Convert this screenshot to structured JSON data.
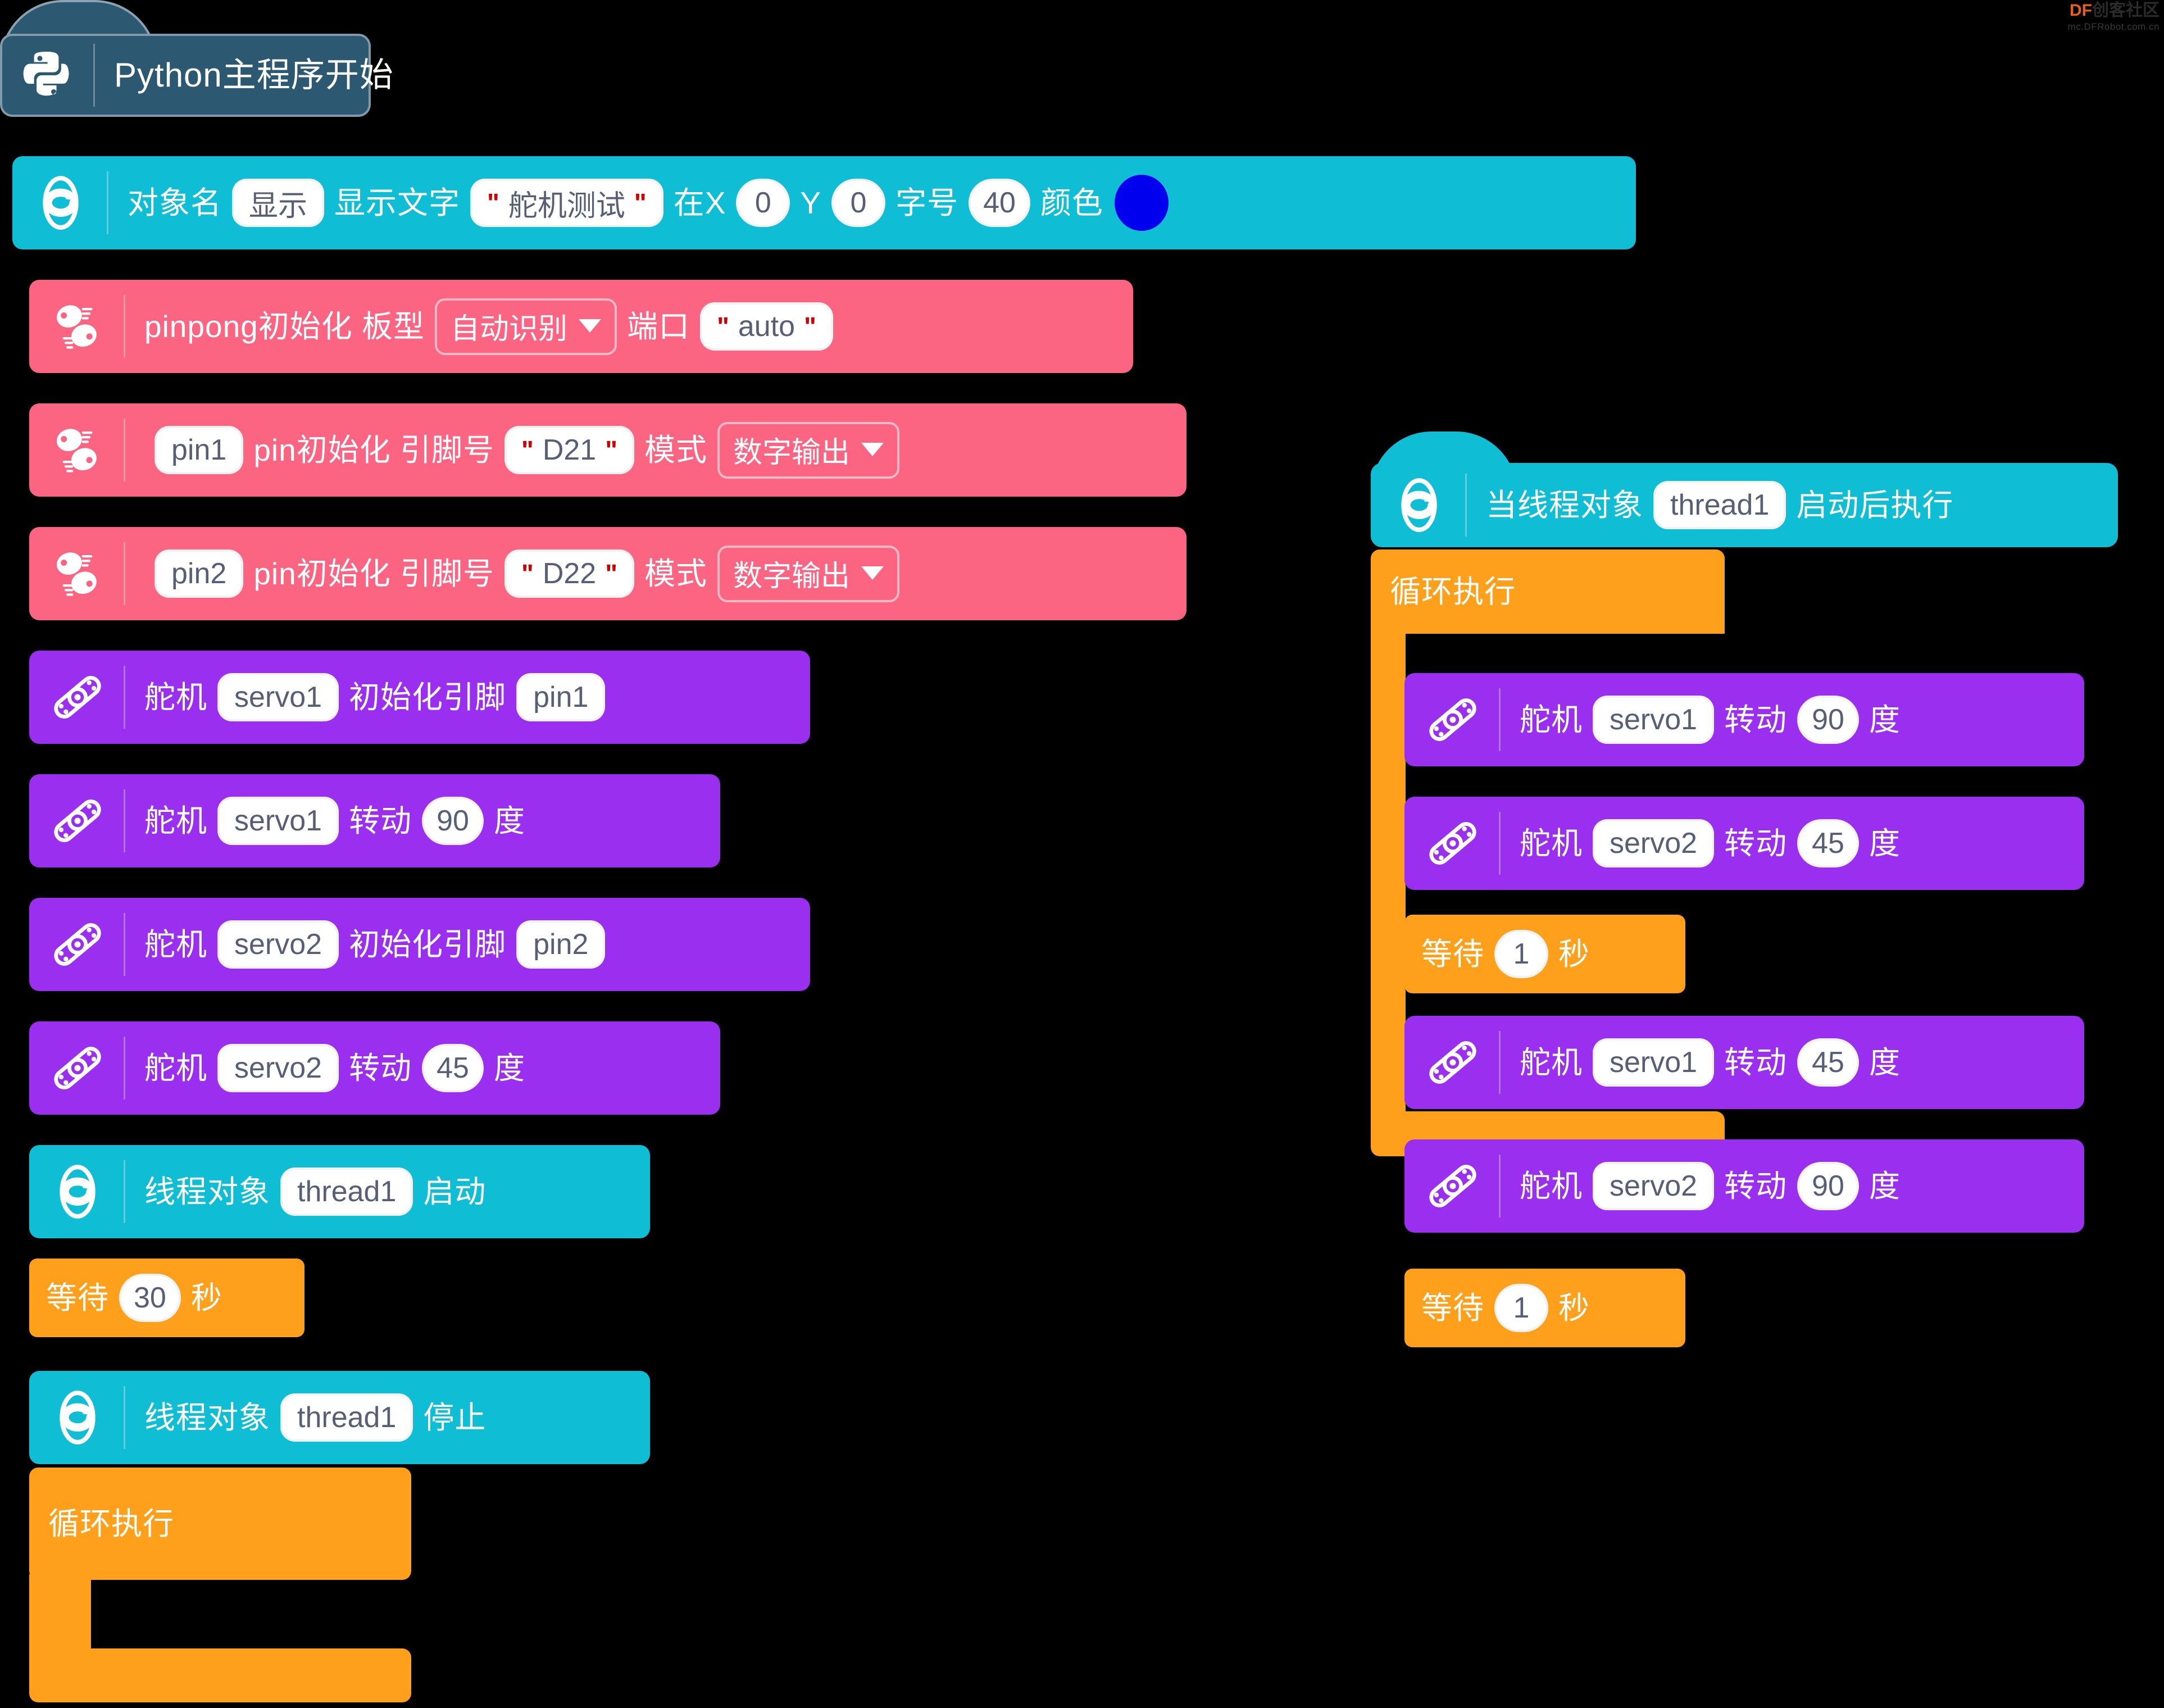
{
  "watermark": {
    "brand": "DF",
    "name": "创客社区",
    "url": "mc.DFRobot.com.cn"
  },
  "colors": {
    "hat": "#2d5871",
    "cyan": "#0FBDD5",
    "pink": "#FC6581",
    "purple": "#9B2FEF",
    "orange": "#FFA01C",
    "text_color_value": "#0000EE"
  },
  "main_script": {
    "hat": {
      "label": "Python主程序开始",
      "icon": "python-logo-icon"
    },
    "display_block": {
      "icon": "thread-object-icon",
      "label_object": "对象名",
      "object_name": "显示",
      "label_text": "显示文字",
      "text_value": "舵机测试",
      "label_x": "在X",
      "x_value": "0",
      "label_y": "Y",
      "y_value": "0",
      "label_size": "字号",
      "size_value": "40",
      "label_color": "颜色",
      "color_value": "#0000EE"
    },
    "pinpong_init": {
      "icon": "pinpong-icon",
      "label": "pinpong初始化 板型",
      "board": "自动识别",
      "label_port": "端口",
      "port": "auto"
    },
    "pin_inits": [
      {
        "icon": "pinpong-icon",
        "var": "pin1",
        "label": "pin初始化 引脚号",
        "pin": "D21",
        "label_mode": "模式",
        "mode": "数字输出"
      },
      {
        "icon": "pinpong-icon",
        "var": "pin2",
        "label": "pin初始化 引脚号",
        "pin": "D22",
        "label_mode": "模式",
        "mode": "数字输出"
      }
    ],
    "servo_blocks": [
      {
        "icon": "servo-icon",
        "label": "舵机",
        "var": "servo1",
        "action": "初始化引脚",
        "value": "pin1",
        "unit": ""
      },
      {
        "icon": "servo-icon",
        "label": "舵机",
        "var": "servo1",
        "action": "转动",
        "value": "90",
        "unit": "度"
      },
      {
        "icon": "servo-icon",
        "label": "舵机",
        "var": "servo2",
        "action": "初始化引脚",
        "value": "pin2",
        "unit": ""
      },
      {
        "icon": "servo-icon",
        "label": "舵机",
        "var": "servo2",
        "action": "转动",
        "value": "45",
        "unit": "度"
      }
    ],
    "thread_start": {
      "icon": "thread-object-icon",
      "label": "线程对象",
      "var": "thread1",
      "action": "启动"
    },
    "wait_block": {
      "label": "等待",
      "value": "30",
      "unit": "秒"
    },
    "thread_stop": {
      "icon": "thread-object-icon",
      "label": "线程对象",
      "var": "thread1",
      "action": "停止"
    },
    "forever_loop": {
      "label": "循环执行"
    }
  },
  "thread_script": {
    "hat": {
      "icon": "thread-object-icon",
      "label_pre": "当线程对象",
      "var": "thread1",
      "label_post": "启动后执行"
    },
    "forever_loop": {
      "label": "循环执行"
    },
    "steps": [
      {
        "type": "servo",
        "icon": "servo-icon",
        "label": "舵机",
        "var": "servo1",
        "action": "转动",
        "value": "90",
        "unit": "度"
      },
      {
        "type": "servo",
        "icon": "servo-icon",
        "label": "舵机",
        "var": "servo2",
        "action": "转动",
        "value": "45",
        "unit": "度"
      },
      {
        "type": "wait",
        "label": "等待",
        "value": "1",
        "unit": "秒"
      },
      {
        "type": "servo",
        "icon": "servo-icon",
        "label": "舵机",
        "var": "servo1",
        "action": "转动",
        "value": "45",
        "unit": "度"
      },
      {
        "type": "servo",
        "icon": "servo-icon",
        "label": "舵机",
        "var": "servo2",
        "action": "转动",
        "value": "90",
        "unit": "度"
      },
      {
        "type": "wait",
        "label": "等待",
        "value": "1",
        "unit": "秒"
      }
    ]
  }
}
